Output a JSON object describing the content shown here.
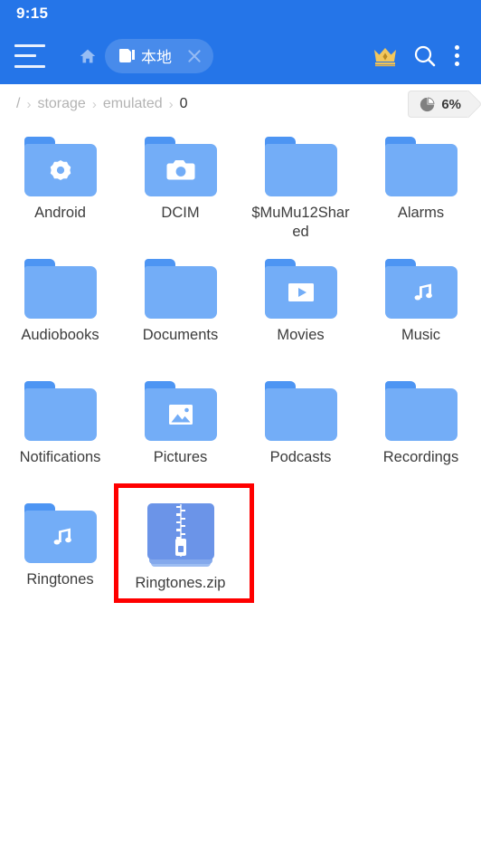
{
  "status_bar": {
    "time": "9:15"
  },
  "app_bar": {
    "menu_icon": "hamburger-menu-icon",
    "home_icon": "home-icon",
    "tab": {
      "icon": "sd-card-icon",
      "label": "本地",
      "close_icon": "close-icon"
    },
    "actions": [
      {
        "name": "vip-crown-icon",
        "label": "VIP"
      },
      {
        "name": "search-icon",
        "label": "Search"
      },
      {
        "name": "overflow-menu-icon",
        "label": "More options"
      }
    ]
  },
  "breadcrumb": {
    "root": "/",
    "separator": "›",
    "items": [
      {
        "label": "storage",
        "current": false
      },
      {
        "label": "emulated",
        "current": false
      },
      {
        "label": "0",
        "current": true
      }
    ]
  },
  "storage_badge": {
    "icon": "pie-chart-icon",
    "percent": "6%"
  },
  "files": [
    {
      "name": "Android",
      "type": "folder",
      "glyph": "gear-icon"
    },
    {
      "name": "DCIM",
      "type": "folder",
      "glyph": "camera-icon"
    },
    {
      "name": "$MuMu12Shared",
      "type": "folder",
      "glyph": "none"
    },
    {
      "name": "Alarms",
      "type": "folder",
      "glyph": "none"
    },
    {
      "name": "Audiobooks",
      "type": "folder",
      "glyph": "none"
    },
    {
      "name": "Documents",
      "type": "folder",
      "glyph": "none"
    },
    {
      "name": "Movies",
      "type": "folder",
      "glyph": "video-icon"
    },
    {
      "name": "Music",
      "type": "folder",
      "glyph": "music-note-icon"
    },
    {
      "name": "Notifications",
      "type": "folder",
      "glyph": "none"
    },
    {
      "name": "Pictures",
      "type": "folder",
      "glyph": "image-icon"
    },
    {
      "name": "Podcasts",
      "type": "folder",
      "glyph": "none"
    },
    {
      "name": "Recordings",
      "type": "folder",
      "glyph": "none"
    },
    {
      "name": "Ringtones",
      "type": "folder",
      "glyph": "music-note-icon"
    },
    {
      "name": "Ringtones.zip",
      "type": "zip",
      "glyph": "zip-icon",
      "highlighted": true
    }
  ],
  "colors": {
    "app_bar": "#2575E8",
    "folder_body": "#73ADF7",
    "folder_tab": "#4D95F3",
    "zip_body": "#6B94E8",
    "highlight": "#FF0000",
    "crown": "#F2C75C",
    "text_primary": "#3c3c3c",
    "text_muted": "#b3b3b3"
  }
}
